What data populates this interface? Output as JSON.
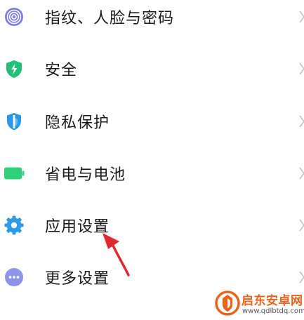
{
  "settings": {
    "items": [
      {
        "label": "指纹、人脸与密码",
        "icon": "fingerprint-icon",
        "color": "#7b7fe6"
      },
      {
        "label": "安全",
        "icon": "shield-icon",
        "color": "#22c07a"
      },
      {
        "label": "隐私保护",
        "icon": "privacy-shield-icon",
        "color": "#2b97e6"
      },
      {
        "label": "省电与电池",
        "icon": "battery-icon",
        "color": "#2fd07a"
      },
      {
        "label": "应用设置",
        "icon": "gear-icon",
        "color": "#2e9be8"
      },
      {
        "label": "更多设置",
        "icon": "more-dots-icon",
        "color": "#8e95e8"
      }
    ]
  },
  "annotation": {
    "arrow_color": "#e0282e"
  },
  "watermark": {
    "title": "启东安卓网",
    "url": "www.qdlbtdq.com",
    "color": "#e8641c"
  }
}
